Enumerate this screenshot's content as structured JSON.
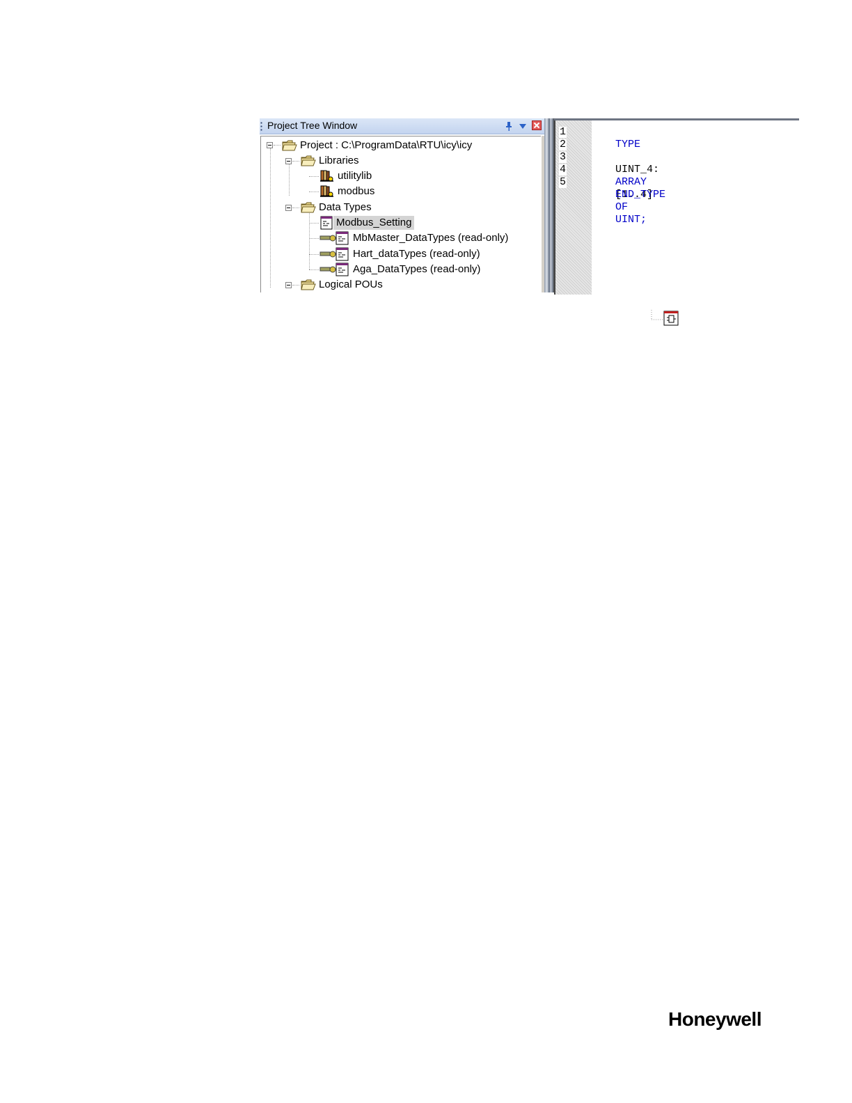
{
  "tree_window": {
    "title": "Project Tree Window",
    "icons": [
      "pin-icon",
      "dropdown-icon",
      "close-icon"
    ],
    "nodes": [
      {
        "label": "Project : C:\\ProgramData\\RTU\\icy\\icy",
        "icon": "folder-icon",
        "expanded": true
      },
      {
        "label": "Libraries",
        "icon": "folder-icon",
        "expanded": true
      },
      {
        "label": "utilitylib",
        "icon": "library-icon"
      },
      {
        "label": "modbus",
        "icon": "library-icon"
      },
      {
        "label": "Data Types",
        "icon": "folder-icon",
        "expanded": true
      },
      {
        "label": "Modbus_Setting",
        "icon": "datatype-icon",
        "selected": true
      },
      {
        "label": "MbMaster_DataTypes (read-only)",
        "icon": "readonly-datatype-icon"
      },
      {
        "label": "Hart_dataTypes (read-only)",
        "icon": "readonly-datatype-icon"
      },
      {
        "label": "Aga_DataTypes (read-only)",
        "icon": "readonly-datatype-icon"
      },
      {
        "label": "Logical POUs",
        "icon": "folder-icon",
        "expanded": true
      }
    ]
  },
  "editor": {
    "line_numbers": [
      "1",
      "2",
      "3",
      "4",
      "5"
    ],
    "lines": {
      "l1": {
        "kw": "TYPE"
      },
      "l3": {
        "ident": "UINT_4:",
        "kw1": "ARRAY",
        "range": "[1..4]",
        "kw2": "OF",
        "kw3": "UINT",
        "semi": ";"
      },
      "l5": {
        "kw": "END_TYPE"
      }
    },
    "colors": {
      "keyword": "#0000c8",
      "text": "#000000"
    }
  },
  "function_block_icon": "function-block-icon",
  "logo": "Honeywell"
}
